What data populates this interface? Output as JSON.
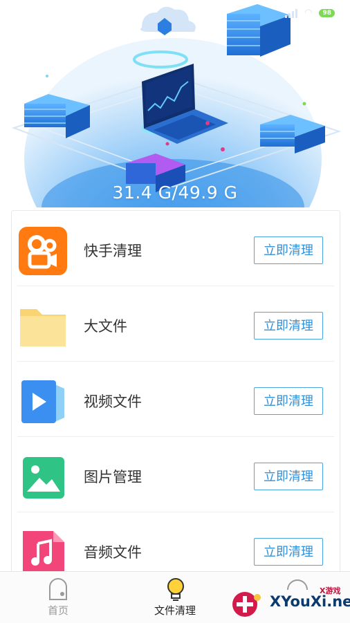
{
  "status_bar": {
    "battery": "98"
  },
  "hero": {
    "storage_text": "31.4 G/49.9 G"
  },
  "items": [
    {
      "label": "快手清理",
      "button": "立即清理",
      "icon": "kuaishou-app-icon",
      "color": "#ff7a10"
    },
    {
      "label": "大文件",
      "button": "立即清理",
      "icon": "folder-icon",
      "color": "#fbe08c"
    },
    {
      "label": "视频文件",
      "button": "立即清理",
      "icon": "video-file-icon",
      "color": "#3a8ff0"
    },
    {
      "label": "图片管理",
      "button": "立即清理",
      "icon": "image-icon",
      "color": "#2fc486"
    },
    {
      "label": "音频文件",
      "button": "立即清理",
      "icon": "music-file-icon",
      "color": "#f2467a"
    }
  ],
  "tabs": [
    {
      "label": "首页",
      "icon": "phone-icon",
      "active": false
    },
    {
      "label": "文件清理",
      "icon": "lightbulb-icon",
      "active": true
    }
  ],
  "watermark": {
    "text": "XYouXi.net",
    "small": "X游戏"
  },
  "colors": {
    "accent": "#2f91d9",
    "hero_blue": "#3aa0f0"
  }
}
